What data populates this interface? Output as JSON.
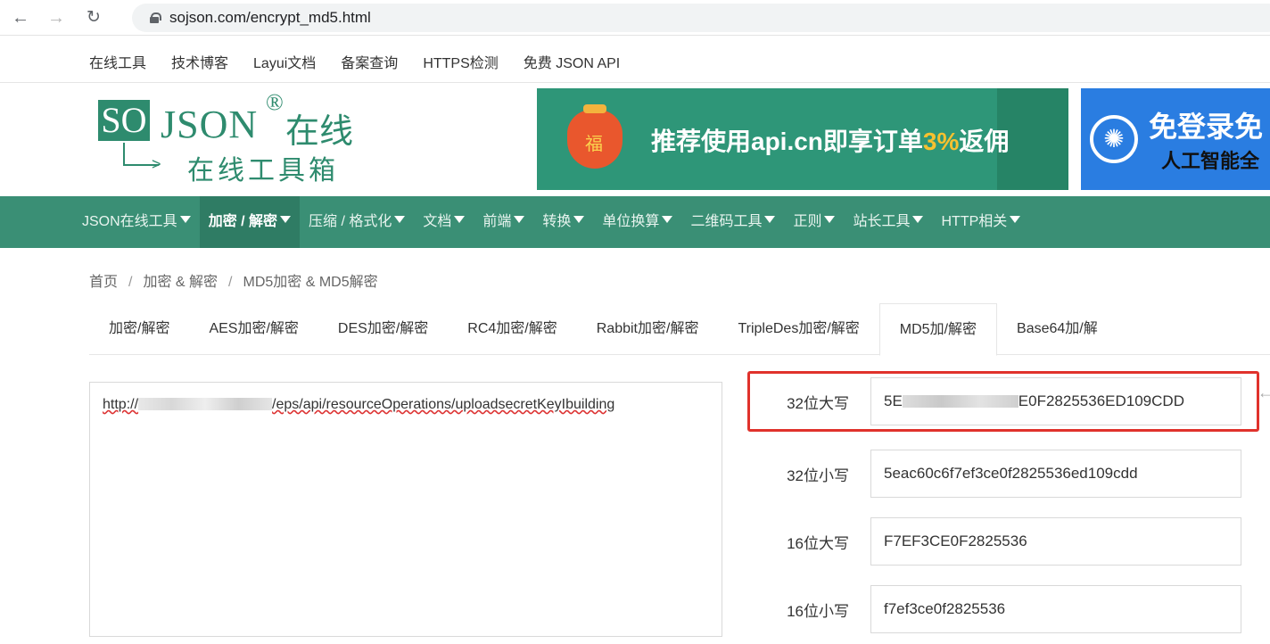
{
  "browser": {
    "back_icon": "arrow-left-icon",
    "forward_icon": "arrow-right-icon",
    "reload_icon": "reload-icon",
    "url": "sojson.com/encrypt_md5.html"
  },
  "top_links": [
    "在线工具",
    "技术博客",
    "Layui文档",
    "备案查询",
    "HTTPS检测",
    "免费 JSON API"
  ],
  "logo": {
    "so": "SO",
    "json": "JSON",
    "reg": "®",
    "online": "在线",
    "subtitle": "在线工具箱"
  },
  "banner1": {
    "bag_char": "福",
    "text_a": "推荐使用api.cn即享订单",
    "text_hl": "3%",
    "text_b": "返佣"
  },
  "banner2": {
    "line1": "免登录免",
    "line2": "人工智能全"
  },
  "main_nav": [
    {
      "label": "JSON在线工具"
    },
    {
      "label": "加密 / 解密",
      "active": true
    },
    {
      "label": "压缩 / 格式化"
    },
    {
      "label": "文档"
    },
    {
      "label": "前端"
    },
    {
      "label": "转换"
    },
    {
      "label": "单位换算"
    },
    {
      "label": "二维码工具"
    },
    {
      "label": "正则"
    },
    {
      "label": "站长工具"
    },
    {
      "label": "HTTP相关"
    }
  ],
  "breadcrumb": [
    "首页",
    "加密 & 解密",
    "MD5加密 & MD5解密"
  ],
  "tabs": [
    {
      "label": "加密/解密"
    },
    {
      "label": "AES加密/解密"
    },
    {
      "label": "DES加密/解密"
    },
    {
      "label": "RC4加密/解密"
    },
    {
      "label": "Rabbit加密/解密"
    },
    {
      "label": "TripleDes加密/解密"
    },
    {
      "label": "MD5加/解密",
      "active": true
    },
    {
      "label": "Base64加/解"
    }
  ],
  "input": {
    "prefix": "http://",
    "suffix": "/eps/api/resourceOperations/uploadsecretKeyIbuilding"
  },
  "results": {
    "upper32": {
      "label": "32位大写",
      "prefix": "5E",
      "suffix": "E0F2825536ED109CDD"
    },
    "lower32": {
      "label": "32位小写",
      "value": "5eac60c6f7ef3ce0f2825536ed109cdd"
    },
    "upper16": {
      "label": "16位大写",
      "value": "F7EF3CE0F2825536"
    },
    "lower16": {
      "label": "16位小写",
      "value": "f7ef3ce0f2825536"
    }
  },
  "side_arrow": "←",
  "colors": {
    "brand": "#3a8f75",
    "highlight": "#e0322c"
  }
}
